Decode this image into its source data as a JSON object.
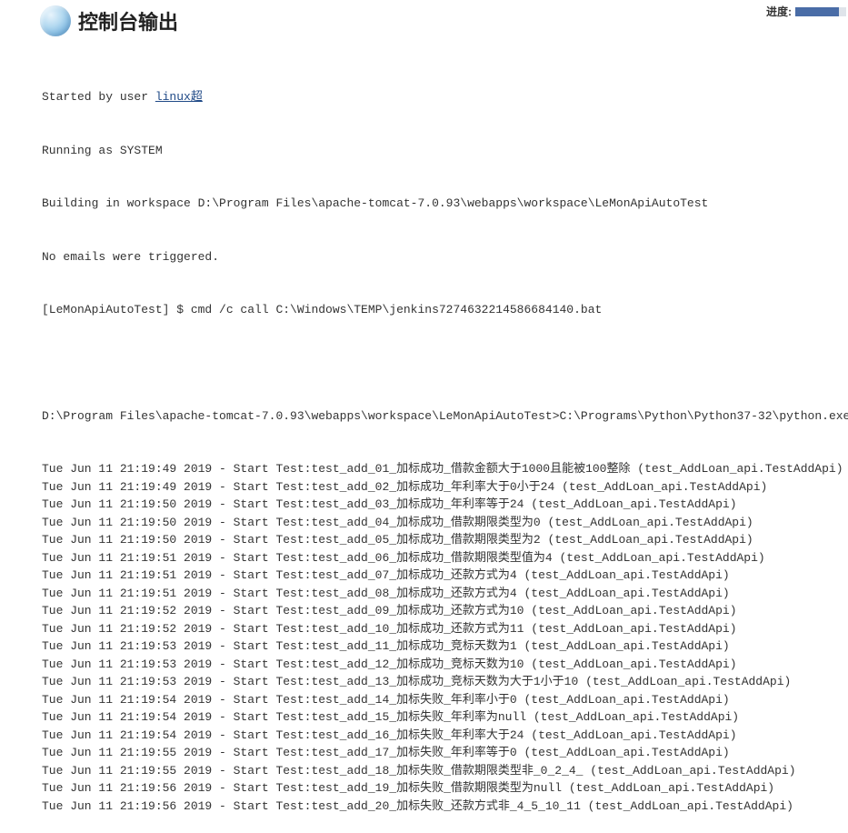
{
  "header": {
    "title": "控制台输出",
    "progress_label": "进度:",
    "progress_percent": 85
  },
  "console": {
    "intro": {
      "started_by_prefix": "Started by user ",
      "user_link": "linux超",
      "running_as": "Running as SYSTEM",
      "workspace": "Building in workspace D:\\Program Files\\apache-tomcat-7.0.93\\webapps\\workspace\\LeMonApiAutoTest",
      "no_emails": "No emails were triggered.",
      "cmd_line": "[LeMonApiAutoTest] $ cmd /c call C:\\Windows\\TEMP\\jenkins7274632214586684140.bat"
    },
    "blank": "",
    "exec_line": "D:\\Program Files\\apache-tomcat-7.0.93\\webapps\\workspace\\LeMonApiAutoTest>C:\\Programs\\Python\\Python37-32\\python.exe run_case.py",
    "tests": [
      "Tue Jun 11 21:19:49 2019 - Start Test:test_add_01_加标成功_借款金额大于1000且能被100整除 (test_AddLoan_api.TestAddApi)",
      "Tue Jun 11 21:19:49 2019 - Start Test:test_add_02_加标成功_年利率大于0小于24 (test_AddLoan_api.TestAddApi)",
      "Tue Jun 11 21:19:50 2019 - Start Test:test_add_03_加标成功_年利率等于24 (test_AddLoan_api.TestAddApi)",
      "Tue Jun 11 21:19:50 2019 - Start Test:test_add_04_加标成功_借款期限类型为0 (test_AddLoan_api.TestAddApi)",
      "Tue Jun 11 21:19:50 2019 - Start Test:test_add_05_加标成功_借款期限类型为2 (test_AddLoan_api.TestAddApi)",
      "Tue Jun 11 21:19:51 2019 - Start Test:test_add_06_加标成功_借款期限类型值为4 (test_AddLoan_api.TestAddApi)",
      "Tue Jun 11 21:19:51 2019 - Start Test:test_add_07_加标成功_还款方式为4 (test_AddLoan_api.TestAddApi)",
      "Tue Jun 11 21:19:51 2019 - Start Test:test_add_08_加标成功_还款方式为4 (test_AddLoan_api.TestAddApi)",
      "Tue Jun 11 21:19:52 2019 - Start Test:test_add_09_加标成功_还款方式为10 (test_AddLoan_api.TestAddApi)",
      "Tue Jun 11 21:19:52 2019 - Start Test:test_add_10_加标成功_还款方式为11 (test_AddLoan_api.TestAddApi)",
      "Tue Jun 11 21:19:53 2019 - Start Test:test_add_11_加标成功_竞标天数为1 (test_AddLoan_api.TestAddApi)",
      "Tue Jun 11 21:19:53 2019 - Start Test:test_add_12_加标成功_竞标天数为10 (test_AddLoan_api.TestAddApi)",
      "Tue Jun 11 21:19:53 2019 - Start Test:test_add_13_加标成功_竞标天数为大于1小于10 (test_AddLoan_api.TestAddApi)",
      "Tue Jun 11 21:19:54 2019 - Start Test:test_add_14_加标失败_年利率小于0 (test_AddLoan_api.TestAddApi)",
      "Tue Jun 11 21:19:54 2019 - Start Test:test_add_15_加标失败_年利率为null (test_AddLoan_api.TestAddApi)",
      "Tue Jun 11 21:19:54 2019 - Start Test:test_add_16_加标失败_年利率大于24 (test_AddLoan_api.TestAddApi)",
      "Tue Jun 11 21:19:55 2019 - Start Test:test_add_17_加标失败_年利率等于0 (test_AddLoan_api.TestAddApi)",
      "Tue Jun 11 21:19:55 2019 - Start Test:test_add_18_加标失败_借款期限类型非_0_2_4_ (test_AddLoan_api.TestAddApi)",
      "Tue Jun 11 21:19:56 2019 - Start Test:test_add_19_加标失败_借款期限类型为null (test_AddLoan_api.TestAddApi)",
      "Tue Jun 11 21:19:56 2019 - Start Test:test_add_20_加标失败_还款方式非_4_5_10_11 (test_AddLoan_api.TestAddApi)"
    ]
  }
}
